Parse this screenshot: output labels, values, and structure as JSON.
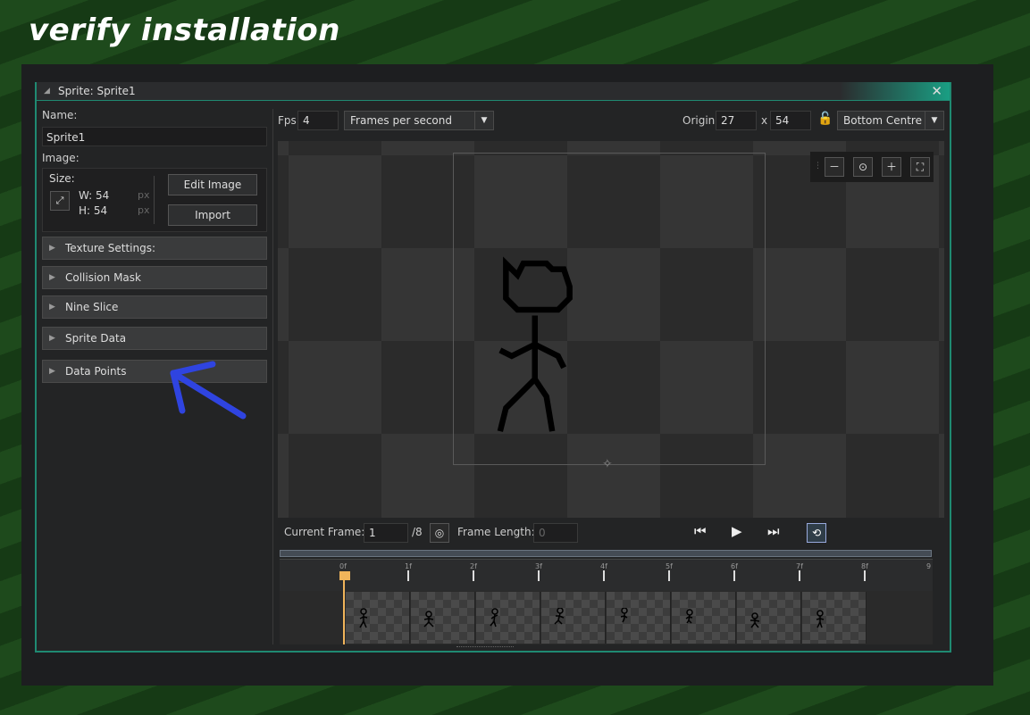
{
  "heading": "verify installation",
  "window": {
    "title": "Sprite: Sprite1",
    "close": "✕"
  },
  "left": {
    "name_label": "Name:",
    "name_value": "Sprite1",
    "image_label": "Image:",
    "size_label": "Size:",
    "width": "W: 54",
    "height": "H: 54",
    "unit": "px",
    "edit_image": "Edit Image",
    "import": "Import",
    "sections": [
      "Texture Settings:",
      "Collision Mask",
      "Nine Slice",
      "Sprite Data",
      "Data Points"
    ]
  },
  "toolbar": {
    "fps_label": "Fps",
    "fps_value": "4",
    "speed_mode": "Frames per second",
    "origin_label": "Origin",
    "origin_x": "27",
    "x_sep": "x",
    "origin_y": "54",
    "origin_preset": "Bottom Centre"
  },
  "playback": {
    "current_frame_label": "Current Frame:",
    "current_frame": "1",
    "frame_total": "/8",
    "frame_length_label": "Frame Length:",
    "frame_length": "0"
  },
  "timeline": {
    "tick_labels": [
      "0f",
      "1f",
      "2f",
      "3f",
      "4f",
      "5f",
      "6f",
      "7f",
      "8f",
      "9"
    ],
    "frame_count": 8
  },
  "colors": {
    "accent": "#1f8a72",
    "playhead": "#f0b45a",
    "annotation_arrow": "#2f44e0"
  }
}
